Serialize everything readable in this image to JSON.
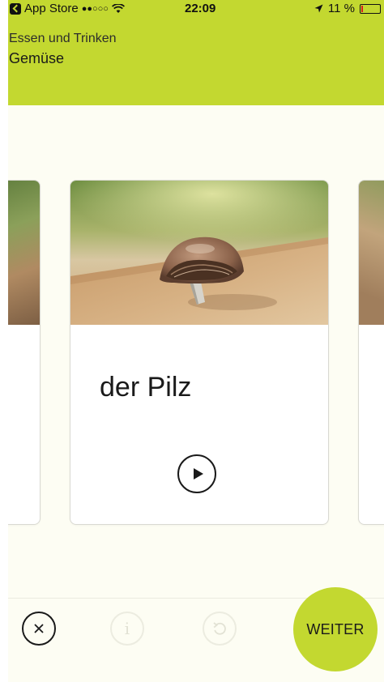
{
  "status_bar": {
    "back_app": "App Store",
    "signal": "●●○○○",
    "time": "22:09",
    "battery_percent": "11 %",
    "battery_level": 0.11,
    "battery_color": "#d81c1c"
  },
  "header": {
    "subtitle": "Essen und Trinken",
    "title": "Gemüse",
    "background_color": "#c3d830"
  },
  "card": {
    "word": "der Pilz",
    "image_icon": "mushroom-photo",
    "play_icon": "play-icon"
  },
  "toolbar": {
    "close_icon": "close-icon",
    "info_icon": "info-icon",
    "undo_icon": "undo-icon",
    "info_symbol": "i",
    "next_label": "WEITER",
    "accent_color": "#c3d830"
  }
}
